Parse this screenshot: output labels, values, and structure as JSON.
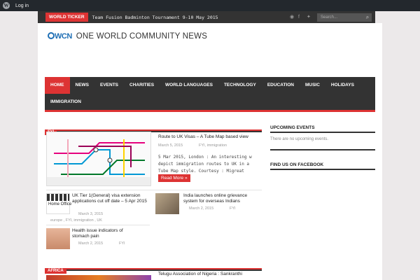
{
  "adminbar": {
    "logo_glyph": "W",
    "login_label": "Log in"
  },
  "topbar": {
    "ticker_label": "WORLD TICKER",
    "ticker_text": "Team Fusion Badminton Tournament 9-10 May 2015",
    "social_icons": [
      "rss-icon",
      "facebook-icon",
      "twitter-icon"
    ],
    "search_placeholder": "Search..."
  },
  "header": {
    "logo_mark": "WCN",
    "site_title": "ONE WORLD COMMUNITY NEWS"
  },
  "nav": {
    "row1": [
      "HOME",
      "NEWS",
      "EVENTS",
      "CHARITIES",
      "WORLD LANGUAGES",
      "TECHNOLOGY",
      "EDUCATION",
      "MUSIC",
      "HOLIDAYS"
    ],
    "row2": [
      "IMMIGRATION"
    ],
    "active": "HOME"
  },
  "block1": {
    "category": "FYI",
    "feature": {
      "title": "Route to UK Visas – A Tube Map based view",
      "date": "March 5, 2015",
      "tags": "FYI, immigration",
      "excerpt": "5 Mar 2015, London : An interesting w depict immigration routes to UK in a Tube Map style. Courtesy : Migreat",
      "read_more": "Read More »"
    },
    "items": [
      {
        "title": "UK Tier 1(General) visa extension applications cut off date – 5 Apr 2015",
        "date": "March 3, 2015",
        "tags": "europe , FYI, immigration , UK",
        "img_label": "Home Office"
      },
      {
        "title": "India launches online grievance system for overseas Indians",
        "date": "March 2, 2015",
        "tags": "FYI"
      },
      {
        "title": "Health issue indicators of stomach pain",
        "date": "March 2, 2015",
        "tags": "FYI"
      }
    ]
  },
  "block2": {
    "category": "AFRICA",
    "feature_title": "Telugu Association of Nigeria : Sankranthi"
  },
  "sidebar": {
    "upcoming_title": "UPCOMING EVENTS",
    "upcoming_text": "There are no upcoming events.",
    "facebook_title": "FIND US ON FACEBOOK"
  },
  "colors": {
    "accent": "#dd3333",
    "dark": "#333333",
    "logo_blue": "#1f6fb5"
  }
}
